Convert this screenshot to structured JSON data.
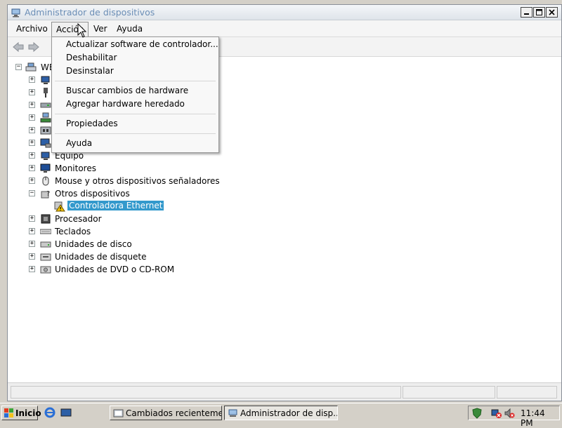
{
  "window": {
    "title": "Administrador de dispositivos",
    "title_color": "#6b8eb6"
  },
  "menubar": {
    "items": [
      {
        "label": "Archivo"
      },
      {
        "label": "Acción"
      },
      {
        "label": "Ver"
      },
      {
        "label": "Ayuda"
      }
    ],
    "active_label": "Acción"
  },
  "toolbar": {
    "back_icon": "back-arrow-icon",
    "forward_icon": "forward-arrow-icon"
  },
  "action_menu": {
    "items": [
      {
        "label": "Actualizar software de controlador..."
      },
      {
        "label": "Deshabilitar"
      },
      {
        "label": "Desinstalar"
      },
      {
        "label": "Buscar cambios de hardware"
      },
      {
        "label": "Agregar hardware heredado"
      },
      {
        "label": "Propiedades"
      },
      {
        "label": "Ayuda"
      }
    ]
  },
  "tree": {
    "root": {
      "label": "WE"
    },
    "categories": [
      {
        "label": "",
        "icon": "computer-icon"
      },
      {
        "label": "",
        "icon": "usb-controller-icon"
      },
      {
        "label": "",
        "icon": "ide-controller-icon"
      },
      {
        "label": "",
        "icon": "network-adapter-icon"
      },
      {
        "label": "",
        "icon": "port-icon"
      },
      {
        "label": "",
        "icon": "display-adapter-icon"
      },
      {
        "label": "Equipo",
        "icon": "computer-icon"
      },
      {
        "label": "Monitores",
        "icon": "monitor-icon"
      },
      {
        "label": "Mouse y otros dispositivos señaladores",
        "icon": "mouse-icon"
      },
      {
        "label": "Otros dispositivos",
        "icon": "unknown-device-icon",
        "expanded": true
      },
      {
        "label": "Procesador",
        "icon": "processor-icon"
      },
      {
        "label": "Teclados",
        "icon": "keyboard-icon"
      },
      {
        "label": "Unidades de disco",
        "icon": "disk-drive-icon"
      },
      {
        "label": "Unidades de disquete",
        "icon": "floppy-drive-icon"
      },
      {
        "label": "Unidades de DVD o CD-ROM",
        "icon": "dvd-drive-icon"
      }
    ],
    "child_device": {
      "label": "Controladora Ethernet",
      "icon": "warning-device-icon",
      "selected": true
    }
  },
  "taskbar": {
    "start_label": "Inicio",
    "tasks": [
      {
        "label": "Cambiados recienteme...",
        "active": false
      },
      {
        "label": "Administrador de disp...",
        "active": true
      }
    ],
    "clock": "11:44 PM"
  },
  "colors": {
    "selection": "#3399cc",
    "taskbar": "#d4d0c8"
  }
}
